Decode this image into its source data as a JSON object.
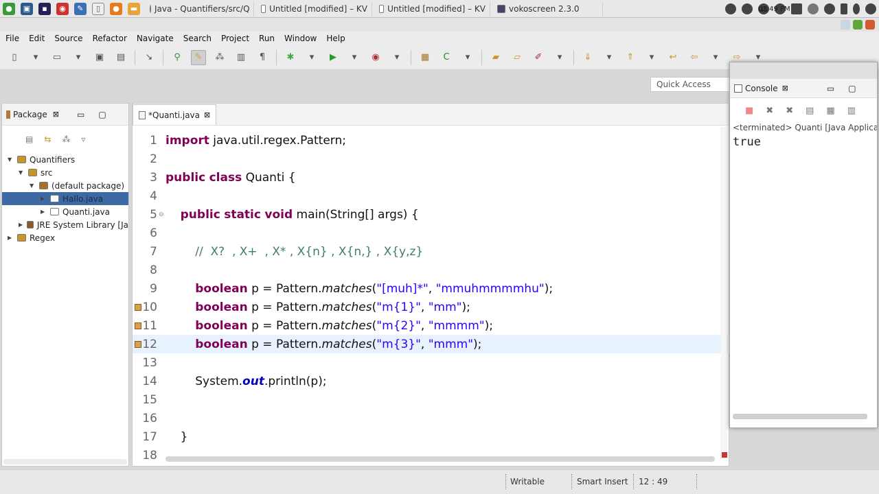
{
  "taskbar": {
    "tasks": [
      {
        "label": "Java - Quantifiers/src/Q"
      },
      {
        "label": "Untitled [modified] – KV"
      },
      {
        "label": "Untitled [modified] – KV"
      },
      {
        "label": "vokoscreen 2.3.0"
      }
    ],
    "keyboard_layout": "us",
    "clock": "02:49 PM"
  },
  "menubar": {
    "items": [
      "File",
      "Edit",
      "Source",
      "Refactor",
      "Navigate",
      "Search",
      "Project",
      "Run",
      "Window",
      "Help"
    ]
  },
  "toolbar": {
    "quick_access": "Quick Access"
  },
  "package_explorer": {
    "tab_label": "Package",
    "tree": [
      {
        "label": "Quantifiers",
        "level": 0,
        "expanded": true
      },
      {
        "label": "src",
        "level": 1,
        "expanded": true
      },
      {
        "label": "(default package)",
        "level": 2,
        "expanded": true
      },
      {
        "label": "Hallo.java",
        "level": 3,
        "expanded": false,
        "selected": true
      },
      {
        "label": "Quanti.java",
        "level": 3,
        "expanded": false
      },
      {
        "label": "JRE System Library [Ja",
        "level": 1,
        "expanded": false
      },
      {
        "label": "Regex",
        "level": 0,
        "expanded": false
      }
    ]
  },
  "editor": {
    "tab_label": "*Quanti.java",
    "current_line": 12,
    "lines": [
      {
        "n": "1",
        "code": "import java.util.regex.Pattern;"
      },
      {
        "n": "2",
        "code": ""
      },
      {
        "n": "3",
        "code": "public class Quanti {"
      },
      {
        "n": "4",
        "code": ""
      },
      {
        "n": "5",
        "code": "    public static void main(String[] args) {"
      },
      {
        "n": "6",
        "code": ""
      },
      {
        "n": "7",
        "code": "        //  X?  , X+  , X* , X{n} , X{n,} , X{y,z}"
      },
      {
        "n": "8",
        "code": ""
      },
      {
        "n": "9",
        "code": "        boolean p = Pattern.matches(\"[muh]*\", \"mmuhmmmmhu\");"
      },
      {
        "n": "10",
        "code": "        boolean p = Pattern.matches(\"m{1}\", \"mm\");"
      },
      {
        "n": "11",
        "code": "        boolean p = Pattern.matches(\"m{2}\", \"mmmm\");"
      },
      {
        "n": "12",
        "code": "        boolean p = Pattern.matches(\"m{3}\", \"mmm\");"
      },
      {
        "n": "13",
        "code": ""
      },
      {
        "n": "14",
        "code": "        System.out.println(p);"
      },
      {
        "n": "15",
        "code": ""
      },
      {
        "n": "16",
        "code": ""
      },
      {
        "n": "17",
        "code": "    }"
      },
      {
        "n": "18",
        "code": ""
      }
    ]
  },
  "console": {
    "tab_label": "Console",
    "status": "<terminated> Quanti [Java Applicat",
    "output": "true"
  },
  "statusbar": {
    "writable": "Writable",
    "insert_mode": "Smart Insert",
    "position": "12 : 49"
  },
  "colors": {
    "keyword": "#7f0055",
    "string": "#2a00ff",
    "comment": "#3f7f5f",
    "current_line": "#e8f2fe",
    "selection": "#3d6aa3"
  }
}
